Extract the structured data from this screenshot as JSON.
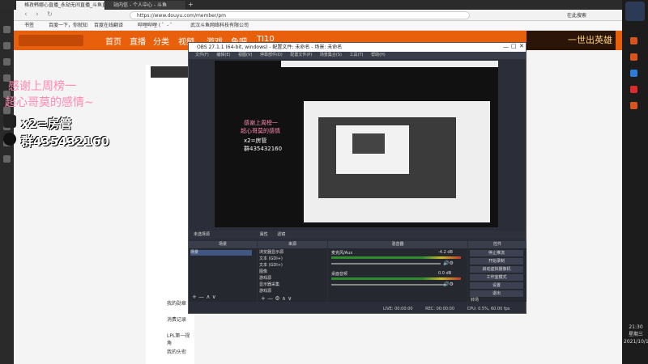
{
  "browser": {
    "tabs": [
      "格孜韩娜心直播_永劫无间直播_斗鱼直",
      "站内信 - 个人中心 - 斗鱼"
    ],
    "url": "https://www.douyu.com/member/pm",
    "search_label": "在此搜索",
    "bookmarks": [
      "书签",
      "百度一下，你就知",
      "百度在线翻译",
      "哔哩哔哩 ( ゜- ゜",
      "武汉斗鱼网络科技有限公司"
    ]
  },
  "douyu": {
    "nav": [
      "首页",
      "直播",
      "分类",
      "视频",
      "游戏",
      "鱼吧",
      "TI10"
    ],
    "side_links": [
      "我的勋章",
      "消费记录",
      "LPL第一视角",
      "我的头衔"
    ],
    "ad_text": "一世出英雄"
  },
  "overlay": {
    "thanks_line1": "感谢上周榜一",
    "thanks_line2": "超心哥莫的感情~",
    "admins": "x2=房管",
    "qq_group": "群435432160"
  },
  "obs": {
    "title": "OBS 27.1.1 (64-bit, windows) - 配置文件: 未命名 - 场景: 未命名",
    "menu": [
      "文件(F)",
      "编辑(E)",
      "视图(V)",
      "停靠部件(D)",
      "配置文件(P)",
      "场景集合(S)",
      "工具(T)",
      "帮助(H)"
    ],
    "scene_bar": [
      "未选择源",
      "属性",
      "滤镜"
    ],
    "docks": [
      "场景",
      "来源",
      "混音器",
      "控件"
    ],
    "scenes": [
      "场景"
    ],
    "sources": [
      "浏览器显示源",
      "文本 (GDI+)",
      "文本 (GDI+)",
      "图像",
      "游戏源",
      "显示器采集",
      "游戏源"
    ],
    "mixer": [
      {
        "name": "麦克风/Aux",
        "db": "-4.2 dB"
      },
      {
        "name": "桌面音频",
        "db": "0.0 dB"
      }
    ],
    "controls": [
      "停止推流",
      "开始录制",
      "启动虚拟摄像机",
      "工作室模式",
      "设置",
      "退出"
    ],
    "transitions_label": "转场",
    "status": {
      "live": "LIVE: 00:00:00",
      "rec": "REC: 00:00:00",
      "cpu": "CPU: 0.5%, 60.00 fps"
    }
  },
  "overlay_preview": {
    "line1": "感谢上周榜一",
    "line2": "超心哥莫的感情",
    "admins": "x2=房管",
    "group": "群435432160"
  },
  "clock": {
    "time": "21:30",
    "weekday": "星期三",
    "date": "2021/10/13"
  }
}
